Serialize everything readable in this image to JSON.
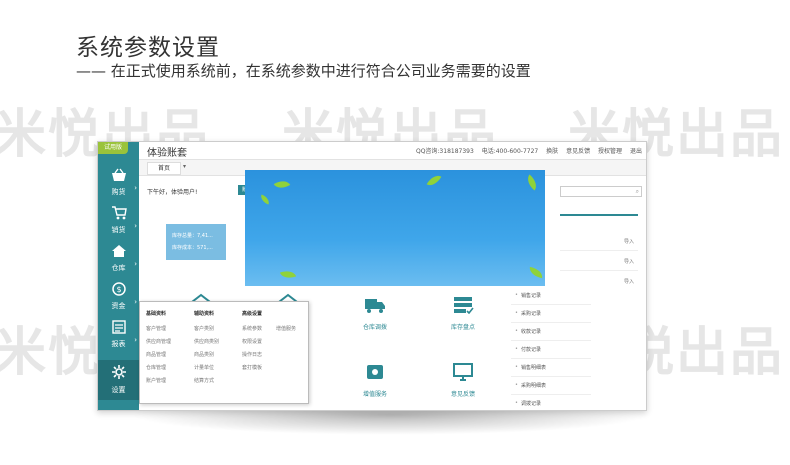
{
  "heading": {
    "title": "系统参数设置",
    "subtitle": "—— 在正式使用系统前，在系统参数中进行符合公司业务需要的设置"
  },
  "watermark_text": "米悦出品",
  "colors": {
    "sidebar": "#2d8993",
    "accent_green": "#9ac33b",
    "banner_blue": "#2b92dd",
    "stock_panel": "#7bbde2"
  },
  "app": {
    "trial_badge": "试用版",
    "title": "体验账套",
    "topbar": {
      "qq": "QQ咨询:318187393",
      "phone": "电话:400-600-7727",
      "items": [
        "换肤",
        "意见反馈",
        "授权管理",
        "退出"
      ]
    },
    "tab_home": "首页",
    "tab_dropdown": "▾",
    "greeting": "下午好，体验用户!",
    "greeting_button": "账户管理",
    "stock": {
      "qty": "库存总量：7,41...",
      "cost": "库存成本：571,..."
    },
    "sidebar": [
      {
        "label": "购货",
        "icon": "basket-icon"
      },
      {
        "label": "销货",
        "icon": "cart-icon"
      },
      {
        "label": "仓库",
        "icon": "house-icon"
      },
      {
        "label": "资金",
        "icon": "money-icon"
      },
      {
        "label": "报表",
        "icon": "report-icon"
      },
      {
        "label": "设置",
        "icon": "gear-icon"
      }
    ],
    "tiles": [
      {
        "label": "仓库调拨",
        "icon": "truck-icon"
      },
      {
        "label": "库存盘点",
        "icon": "checklist-icon"
      },
      {
        "label": "增值服务",
        "icon": "service-icon"
      },
      {
        "label": "意见反馈",
        "icon": "monitor-icon"
      }
    ],
    "right_panel": {
      "link": "导入"
    },
    "menu_list": [
      "销售记录",
      "采购记录",
      "收款记录",
      "付款记录",
      "销售明细表",
      "采购明细表",
      "调拨记录"
    ]
  },
  "submenu": {
    "columns": [
      {
        "head": "基础资料",
        "items": [
          "客户管理",
          "供应商管理",
          "商品管理",
          "仓库管理",
          "账户管理"
        ]
      },
      {
        "head": "辅助资料",
        "items": [
          "客户类别",
          "供应商类别",
          "商品类别",
          "计量单位",
          "结算方式"
        ]
      },
      {
        "head": "高级设置",
        "items": [
          "系统参数",
          "权限设置",
          "操作日志",
          "套打模板"
        ]
      }
    ],
    "extra_item": "增值服务"
  }
}
